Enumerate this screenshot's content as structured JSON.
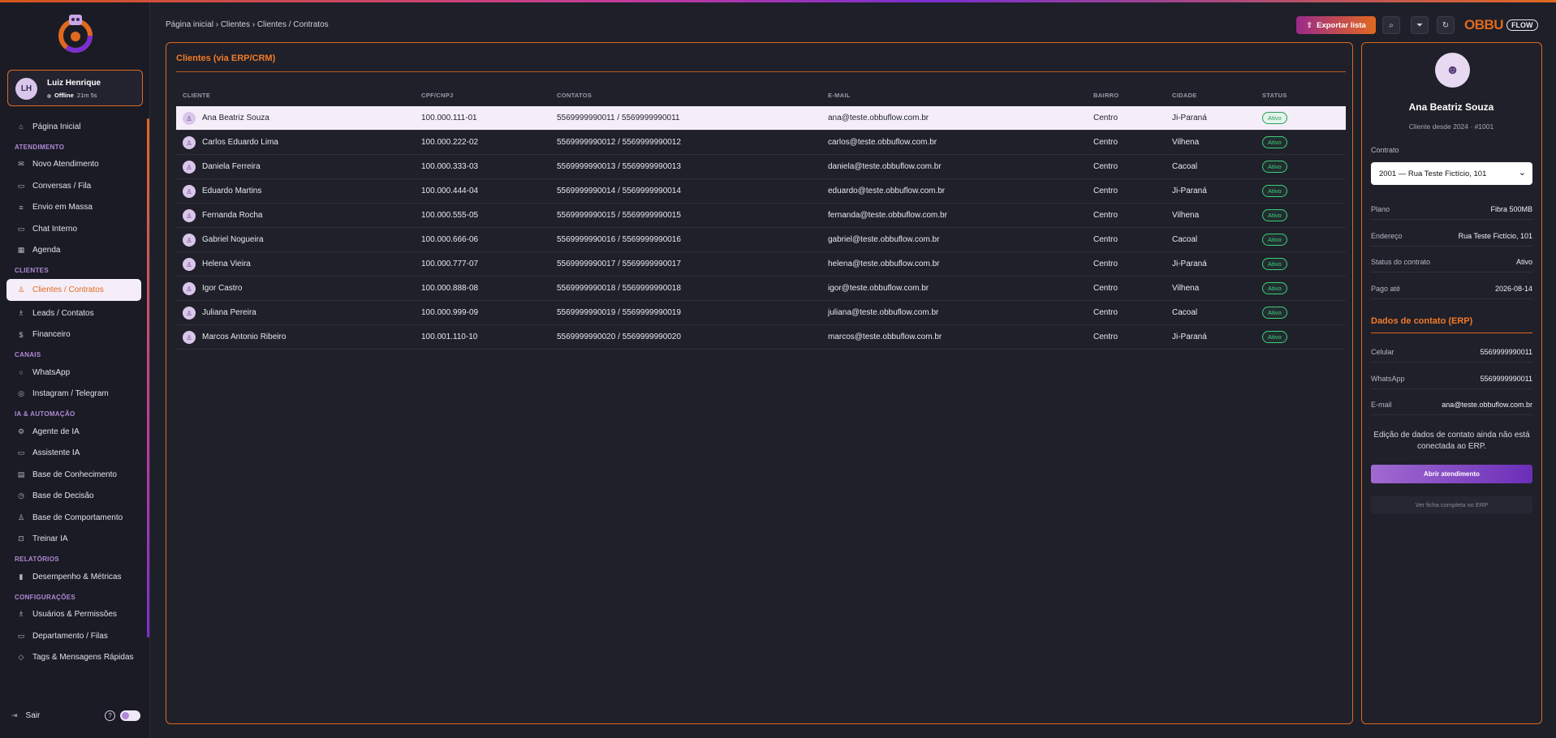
{
  "sidebar": {
    "user": {
      "initials": "LH",
      "name": "Luiz Henrique",
      "status": "Offline",
      "duration": "21m 5s"
    },
    "home": "Página Inicial",
    "sections": [
      {
        "title": "ATENDIMENTO",
        "items": [
          "Novo Atendimento",
          "Conversas / Fila",
          "Envio em Massa",
          "Chat Interno",
          "Agenda"
        ]
      },
      {
        "title": "CLIENTES",
        "items": [
          "Clientes / Contratos",
          "Leads / Contatos",
          "Financeiro"
        ]
      },
      {
        "title": "CANAIS",
        "items": [
          "WhatsApp",
          "Instagram / Telegram"
        ]
      },
      {
        "title": "IA & AUTOMAÇÃO",
        "items": [
          "Agente de IA",
          "Assistente IA",
          "Base de Conhecimento",
          "Base de Decisão",
          "Base de Comportamento",
          "Treinar IA"
        ]
      },
      {
        "title": "RELATÓRIOS",
        "items": [
          "Desempenho & Métricas"
        ]
      },
      {
        "title": "CONFIGURAÇÕES",
        "items": [
          "Usuários & Permissões",
          "Departamento / Filas",
          "Tags & Mensagens Rápidas"
        ]
      }
    ],
    "active_item": "Clientes / Contratos",
    "logout": "Sair",
    "help": "?"
  },
  "header": {
    "breadcrumb": "Página inicial › Clientes › Clientes / Contratos",
    "export_label": "Exportar lista",
    "brand": "OBBU",
    "brand_tag": "FLOW"
  },
  "main": {
    "title": "Clientes (via ERP/CRM)",
    "columns": [
      "CLIENTE",
      "CPF/CNPJ",
      "CONTATOS",
      "E-MAIL",
      "BAIRRO",
      "CIDADE",
      "STATUS"
    ],
    "rows": [
      {
        "name": "Ana Beatriz Souza",
        "doc": "100.000.111-01",
        "contacts": "5569999990011 / 5569999990011",
        "email": "ana@teste.obbuflow.com.br",
        "district": "Centro",
        "city": "Ji-Paraná",
        "status": "Ativo"
      },
      {
        "name": "Carlos Eduardo Lima",
        "doc": "100.000.222-02",
        "contacts": "5569999990012 / 5569999990012",
        "email": "carlos@teste.obbuflow.com.br",
        "district": "Centro",
        "city": "Vilhena",
        "status": "Ativo"
      },
      {
        "name": "Daniela Ferreira",
        "doc": "100.000.333-03",
        "contacts": "5569999990013 / 5569999990013",
        "email": "daniela@teste.obbuflow.com.br",
        "district": "Centro",
        "city": "Cacoal",
        "status": "Ativo"
      },
      {
        "name": "Eduardo Martins",
        "doc": "100.000.444-04",
        "contacts": "5569999990014 / 5569999990014",
        "email": "eduardo@teste.obbuflow.com.br",
        "district": "Centro",
        "city": "Ji-Paraná",
        "status": "Ativo"
      },
      {
        "name": "Fernanda Rocha",
        "doc": "100.000.555-05",
        "contacts": "5569999990015 / 5569999990015",
        "email": "fernanda@teste.obbuflow.com.br",
        "district": "Centro",
        "city": "Vilhena",
        "status": "Ativo"
      },
      {
        "name": "Gabriel Nogueira",
        "doc": "100.000.666-06",
        "contacts": "5569999990016 / 5569999990016",
        "email": "gabriel@teste.obbuflow.com.br",
        "district": "Centro",
        "city": "Cacoal",
        "status": "Ativo"
      },
      {
        "name": "Helena Vieira",
        "doc": "100.000.777-07",
        "contacts": "5569999990017 / 5569999990017",
        "email": "helena@teste.obbuflow.com.br",
        "district": "Centro",
        "city": "Ji-Paraná",
        "status": "Ativo"
      },
      {
        "name": "Igor Castro",
        "doc": "100.000.888-08",
        "contacts": "5569999990018 / 5569999990018",
        "email": "igor@teste.obbuflow.com.br",
        "district": "Centro",
        "city": "Vilhena",
        "status": "Ativo"
      },
      {
        "name": "Juliana Pereira",
        "doc": "100.000.999-09",
        "contacts": "5569999990019 / 5569999990019",
        "email": "juliana@teste.obbuflow.com.br",
        "district": "Centro",
        "city": "Cacoal",
        "status": "Ativo"
      },
      {
        "name": "Marcos Antonio Ribeiro",
        "doc": "100.001.110-10",
        "contacts": "5569999990020 / 5569999990020",
        "email": "marcos@teste.obbuflow.com.br",
        "district": "Centro",
        "city": "Ji-Paraná",
        "status": "Ativo"
      }
    ],
    "selected_row": 0
  },
  "detail": {
    "name": "Ana Beatriz Souza",
    "since": "Cliente desde 2024 · #1001",
    "contract_label": "Contrato",
    "contract_value": "2001 — Rua Teste Fictício, 101",
    "fields": [
      {
        "k": "Plano",
        "v": "Fibra 500MB"
      },
      {
        "k": "Endereço",
        "v": "Rua Teste Fictício, 101"
      },
      {
        "k": "Status do contrato",
        "v": "Ativo"
      },
      {
        "k": "Pago até",
        "v": "2026-08-14"
      }
    ],
    "contact_title": "Dados de contato (ERP)",
    "contact_fields": [
      {
        "k": "Celular",
        "v": "5569999990011"
      },
      {
        "k": "WhatsApp",
        "v": "5569999990011"
      },
      {
        "k": "E-mail",
        "v": "ana@teste.obbuflow.com.br"
      }
    ],
    "note": "Edição de dados de contato ainda não está conectada ao ERP.",
    "open_button": "Abrir atendimento",
    "erp_button": "Ver ficha completa no ERP"
  },
  "colors": {
    "accent": "#e0691f",
    "purple": "#7b2fd1",
    "success": "#3ecf7a",
    "background": "#1d1f29"
  }
}
